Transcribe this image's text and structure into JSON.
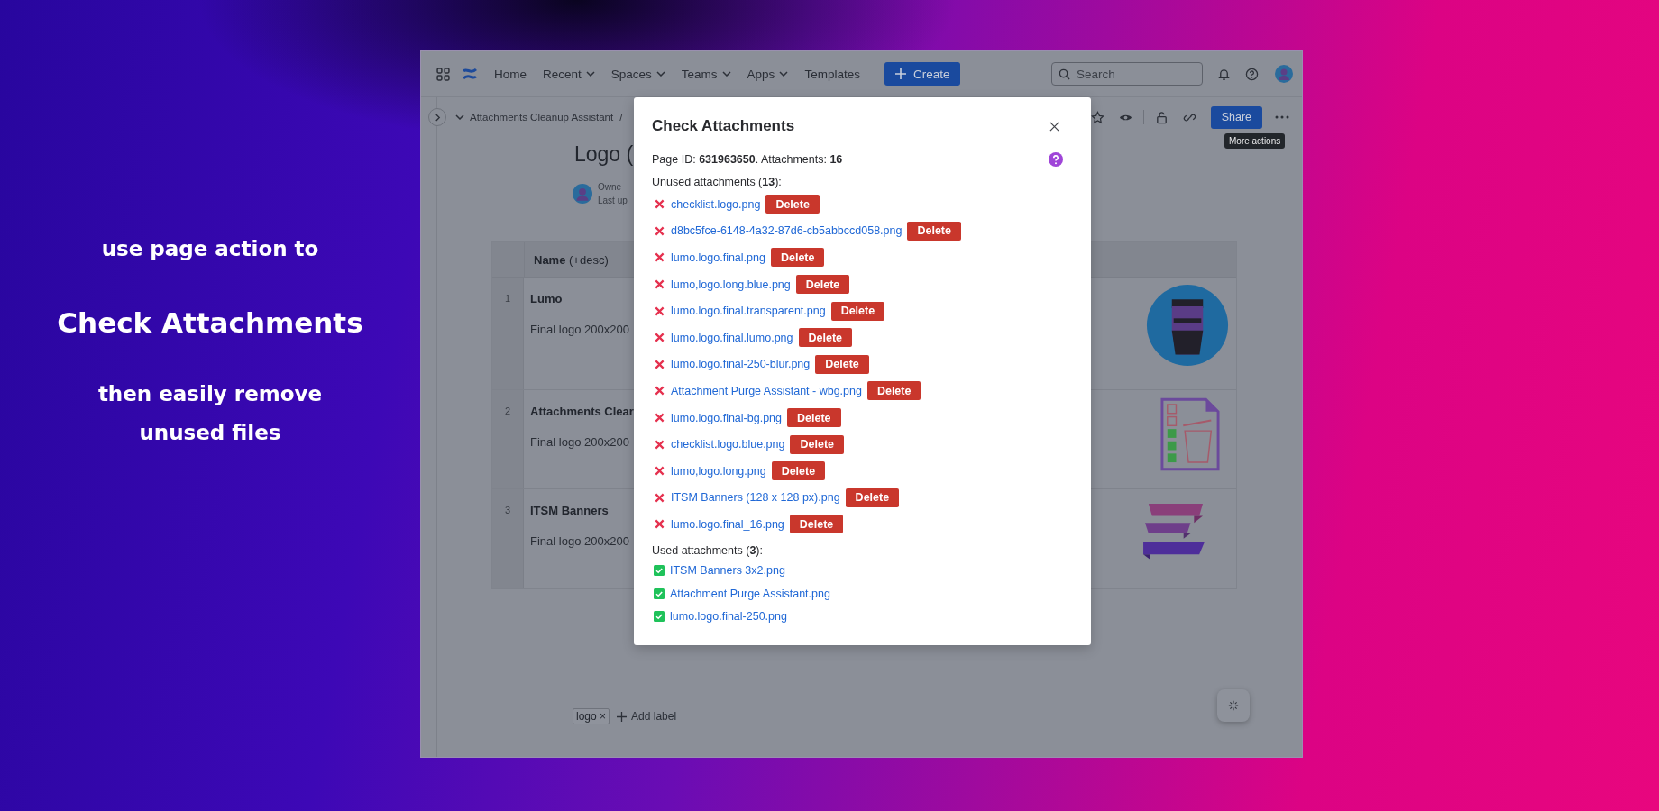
{
  "promo": {
    "lines": [
      {
        "text": "use page action to",
        "kind": "sub"
      },
      {
        "text": "Check Attachments",
        "kind": "headline"
      },
      {
        "text": "then easily remove unused files",
        "kind": "sub"
      }
    ]
  },
  "nav": {
    "items": [
      {
        "label": "Home",
        "dropdown": false
      },
      {
        "label": "Recent",
        "dropdown": true
      },
      {
        "label": "Spaces",
        "dropdown": true
      },
      {
        "label": "Teams",
        "dropdown": true
      },
      {
        "label": "Apps",
        "dropdown": true
      },
      {
        "label": "Templates",
        "dropdown": false
      }
    ],
    "create": "Create",
    "search": {
      "placeholder": "Search"
    }
  },
  "breadcrumb": {
    "text": "Attachments Cleanup Assistant",
    "separator": "/"
  },
  "page_actions": {
    "share": "Share",
    "tooltip": "More actions"
  },
  "page": {
    "title": "Logo (",
    "owner": "Owne",
    "updated": "Last up"
  },
  "table": {
    "header": "**Name** (+desc)",
    "rows": [
      {
        "number": "1",
        "name": "Lumo",
        "desc": "Final logo 200x200"
      },
      {
        "number": "2",
        "name": "Attachments Clear",
        "desc": "Final logo 200x200"
      },
      {
        "number": "3",
        "name": "ITSM Banners",
        "desc": "Final logo 200x200"
      }
    ]
  },
  "labels": [
    {
      "text": "logo",
      "remove": "×"
    }
  ],
  "add_label": "Add label",
  "dialog": {
    "title": "Check Attachments",
    "summary": "Page ID: **631963650**. Attachments: **16**",
    "unused_heading": "Unused attachments (**13**):",
    "unused": [
      {
        "name": "checklist.logo.png",
        "action": "Delete"
      },
      {
        "name": "d8bc5fce-6148-4a32-87d6-cb5abbccd058.png",
        "action": "Delete"
      },
      {
        "name": "lumo.logo.final.png",
        "action": "Delete"
      },
      {
        "name": "lumo,logo.long.blue.png",
        "action": "Delete"
      },
      {
        "name": "lumo.logo.final.transparent.png",
        "action": "Delete"
      },
      {
        "name": "lumo.logo.final.lumo.png",
        "action": "Delete"
      },
      {
        "name": "lumo.logo.final-250-blur.png",
        "action": "Delete"
      },
      {
        "name": "Attachment Purge Assistant - wbg.png",
        "action": "Delete"
      },
      {
        "name": "lumo.logo.final-bg.png",
        "action": "Delete"
      },
      {
        "name": "checklist.logo.blue.png",
        "action": "Delete"
      },
      {
        "name": "lumo,logo.long.png",
        "action": "Delete"
      },
      {
        "name": "ITSM Banners (128 x 128 px).png",
        "action": "Delete"
      },
      {
        "name": "lumo.logo.final_16.png",
        "action": "Delete"
      }
    ],
    "used_heading": "Used attachments (**3**):",
    "used": [
      {
        "name": "ITSM Banners 3x2.png"
      },
      {
        "name": "Attachment Purge Assistant.png"
      },
      {
        "name": "lumo.logo.final-250.png"
      }
    ]
  }
}
